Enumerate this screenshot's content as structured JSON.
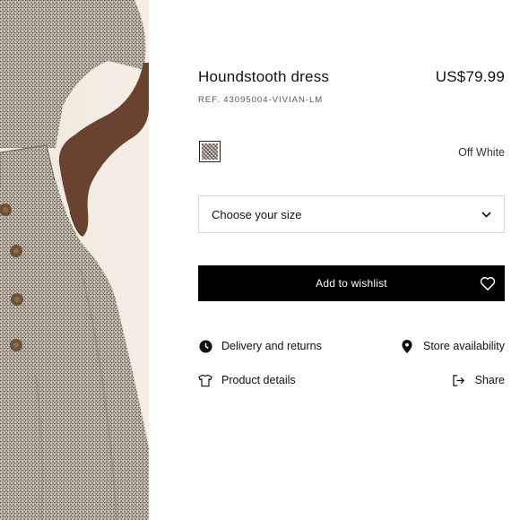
{
  "product": {
    "title": "Houndstooth dress",
    "price": "US$79.99",
    "ref": "REF. 43095004-VIVIAN-LM",
    "color_name": "Off White"
  },
  "size_select": {
    "label": "Choose your size",
    "icon": "chevron-down-icon"
  },
  "wishlist": {
    "label": "Add to wishlist",
    "icon": "heart-icon",
    "background": "#000000"
  },
  "links": {
    "delivery": {
      "label": "Delivery and returns",
      "icon": "clock-icon"
    },
    "store": {
      "label": "Store availability",
      "icon": "location-pin-icon"
    },
    "details": {
      "label": "Product details",
      "icon": "tshirt-icon"
    },
    "share": {
      "label": "Share",
      "icon": "share-icon"
    }
  }
}
